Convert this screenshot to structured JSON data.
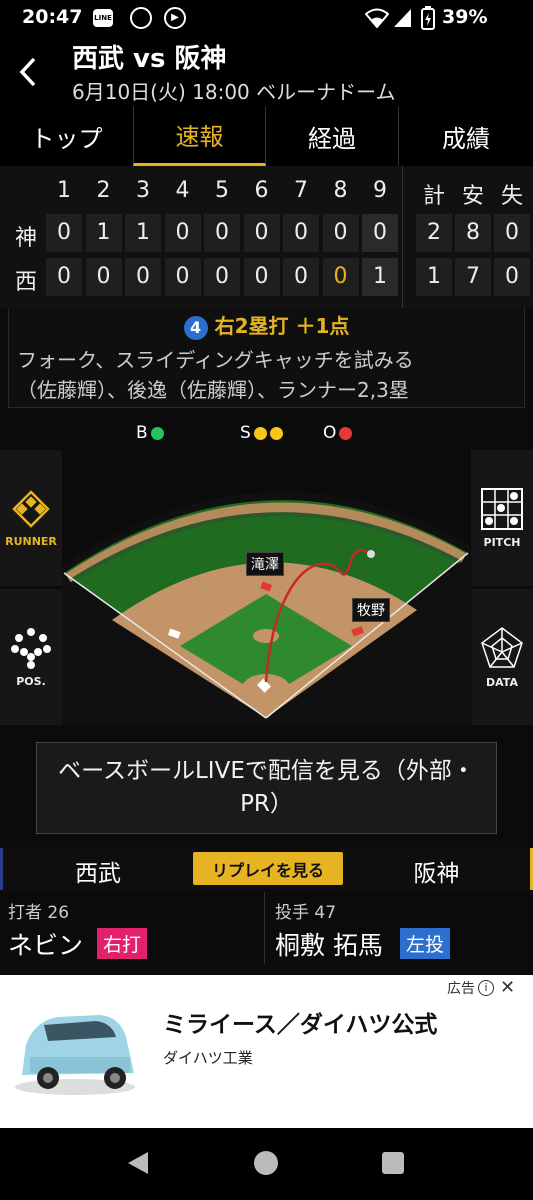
{
  "status": {
    "time": "20:47",
    "battery": "39%"
  },
  "header": {
    "title": "西武 vs 阪神",
    "subtitle": "6月10日(火) 18:00 ベルーナドーム"
  },
  "tabs": [
    {
      "label": "トップ",
      "active": false
    },
    {
      "label": "速報",
      "active": true
    },
    {
      "label": "経過",
      "active": false
    },
    {
      "label": "成績",
      "active": false
    }
  ],
  "scoreboard": {
    "innings": [
      "1",
      "2",
      "3",
      "4",
      "5",
      "6",
      "7",
      "8",
      "9"
    ],
    "totals_headers": [
      "計",
      "安",
      "失"
    ],
    "rows": [
      {
        "team": "神",
        "scores": [
          "0",
          "1",
          "1",
          "0",
          "0",
          "0",
          "0",
          "0",
          "0"
        ],
        "totals": [
          "2",
          "8",
          "0"
        ]
      },
      {
        "team": "西",
        "scores": [
          "0",
          "0",
          "0",
          "0",
          "0",
          "0",
          "0",
          "0",
          "1"
        ],
        "totals": [
          "1",
          "7",
          "0"
        ]
      }
    ]
  },
  "play": {
    "number": "4",
    "title": "右2塁打 ＋1点",
    "line1": "フォーク、スライディングキャッチを試みる",
    "line2": "（佐藤輝）、後逸（佐藤輝）、ランナー2,3塁"
  },
  "count": {
    "b_label": "B",
    "s_label": "S",
    "o_label": "O",
    "balls": 1,
    "strikes": 2,
    "outs": 1
  },
  "field": {
    "runner_label": "RUNNER",
    "pos_label": "POS.",
    "pitch_label": "PITCH",
    "data_label": "DATA",
    "runner1": "滝澤",
    "runner2": "牧野"
  },
  "live_button": "ベースボールLIVEで配信を見る（外部・PR）",
  "team_bar": {
    "left": "西武",
    "replay": "リプレイを見る",
    "right": "阪神"
  },
  "batter": {
    "role": "打者",
    "number": "26",
    "name": "ネビン",
    "badge": "右打"
  },
  "pitcher": {
    "role": "投手",
    "number": "47",
    "name": "桐敷 拓馬",
    "badge": "左投"
  },
  "ad": {
    "tag": "広告",
    "title": "ミライース／ダイハツ公式",
    "sponsor": "ダイハツ工業"
  },
  "colors": {
    "accent": "#e6b422",
    "badge_right": "#e3206b",
    "badge_left": "#2d6fcf",
    "ball": "#22c55e",
    "strike": "#f5c518",
    "out": "#e53935"
  }
}
